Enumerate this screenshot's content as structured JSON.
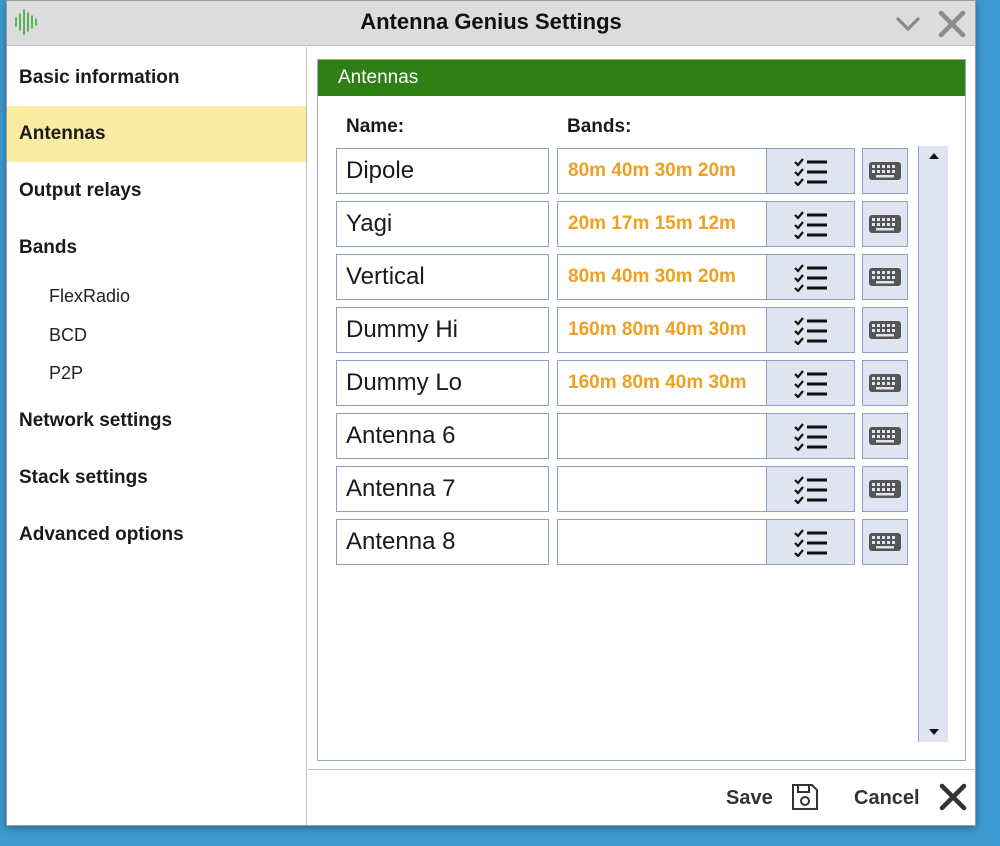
{
  "window": {
    "title": "Antenna Genius Settings"
  },
  "sidebar": {
    "items": [
      {
        "label": "Basic information"
      },
      {
        "label": "Antennas"
      },
      {
        "label": "Output relays"
      },
      {
        "label": "Bands"
      },
      {
        "label": "FlexRadio"
      },
      {
        "label": "BCD"
      },
      {
        "label": "P2P"
      },
      {
        "label": "Network settings"
      },
      {
        "label": "Stack settings"
      },
      {
        "label": "Advanced options"
      }
    ],
    "active": "Antennas"
  },
  "panel": {
    "title": "Antennas",
    "name_header": "Name:",
    "bands_header": "Bands:"
  },
  "antennas": [
    {
      "name": "Dipole",
      "bands": "80m 40m 30m 20m"
    },
    {
      "name": "Yagi",
      "bands": "20m 17m 15m 12m"
    },
    {
      "name": "Vertical",
      "bands": "80m 40m 30m 20m"
    },
    {
      "name": "Dummy Hi",
      "bands": "160m 80m 40m 30m"
    },
    {
      "name": "Dummy Lo",
      "bands": "160m 80m 40m 30m"
    },
    {
      "name": "Antenna 6",
      "bands": ""
    },
    {
      "name": "Antenna 7",
      "bands": ""
    },
    {
      "name": "Antenna 8",
      "bands": ""
    }
  ],
  "footer": {
    "save_label": "Save",
    "cancel_label": "Cancel"
  },
  "colors": {
    "accent_green": "#2f7f16",
    "active_item": "#fbeca4",
    "band_text": "#f0a020"
  }
}
